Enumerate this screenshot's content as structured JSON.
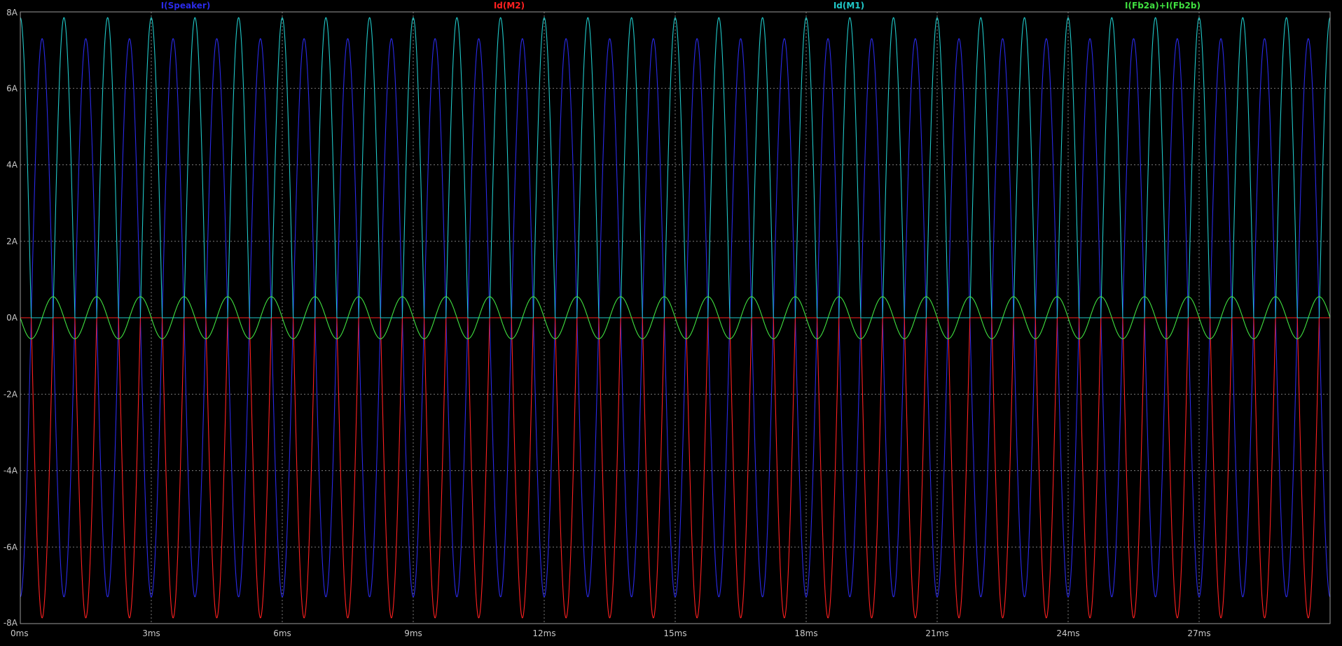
{
  "chart_data": {
    "type": "line",
    "title": "",
    "xlabel": "",
    "ylabel": "",
    "xlim": [
      0,
      30
    ],
    "ylim": [
      -8,
      8
    ],
    "x_unit": "ms",
    "y_unit": "A",
    "x_ticks": [
      "0ms",
      "3ms",
      "6ms",
      "9ms",
      "12ms",
      "15ms",
      "18ms",
      "21ms",
      "24ms",
      "27ms"
    ],
    "y_ticks": [
      "8A",
      "6A",
      "4A",
      "2A",
      "0A",
      "-2A",
      "-4A",
      "-6A",
      "-8A"
    ],
    "grid": true,
    "legend_position": "top",
    "colors": {
      "background": "#000000",
      "grid": "#7a7a7a",
      "axis": "#9a9a9a"
    },
    "series": [
      {
        "name": "I(Speaker)",
        "color": "#2a2ae8",
        "waveform": "sine",
        "frequency_hz": 1000,
        "amplitude": 7.3,
        "offset": 0,
        "phase_deg": -90,
        "rectify": "none"
      },
      {
        "name": "Id(M2)",
        "color": "#ff2020",
        "waveform": "half-wave-negative",
        "frequency_hz": 1000,
        "amplitude": 7.85,
        "offset": 0,
        "phase_deg": 90,
        "rectify": "negative"
      },
      {
        "name": "Id(M1)",
        "color": "#20c8c8",
        "waveform": "half-wave-positive",
        "frequency_hz": 1000,
        "amplitude": 7.85,
        "offset": 0,
        "phase_deg": 90,
        "rectify": "positive"
      },
      {
        "name": "I(Fb2a)+I(Fb2b)",
        "color": "#40e040",
        "waveform": "sine",
        "frequency_hz": 1000,
        "amplitude": 0.55,
        "offset": 0,
        "phase_deg": 180,
        "rectify": "none"
      }
    ]
  }
}
